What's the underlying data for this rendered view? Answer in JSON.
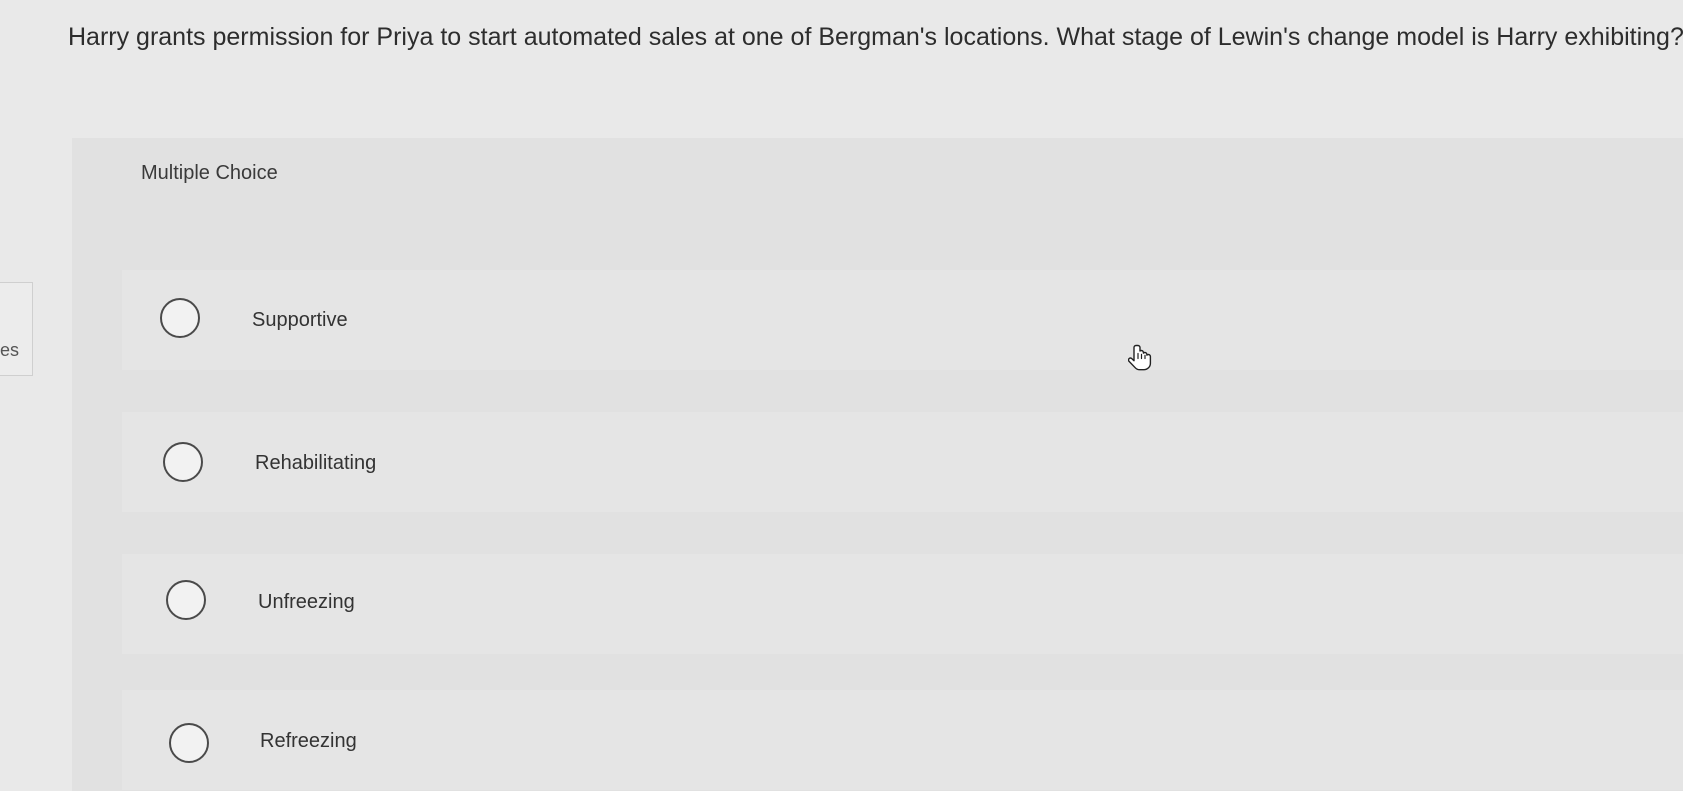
{
  "question": {
    "text": "Harry grants permission for Priya to start automated sales at one of Bergman's locations. What stage of Lewin's change model is Harry exhibiting?"
  },
  "left_edge": {
    "text": "es"
  },
  "section": {
    "label": "Multiple Choice"
  },
  "options": [
    {
      "label": "Supportive"
    },
    {
      "label": "Rehabilitating"
    },
    {
      "label": "Unfreezing"
    },
    {
      "label": "Refreezing"
    }
  ],
  "icons": {
    "cursor": "hand-pointer-icon",
    "radio": "radio-unselected-icon"
  }
}
